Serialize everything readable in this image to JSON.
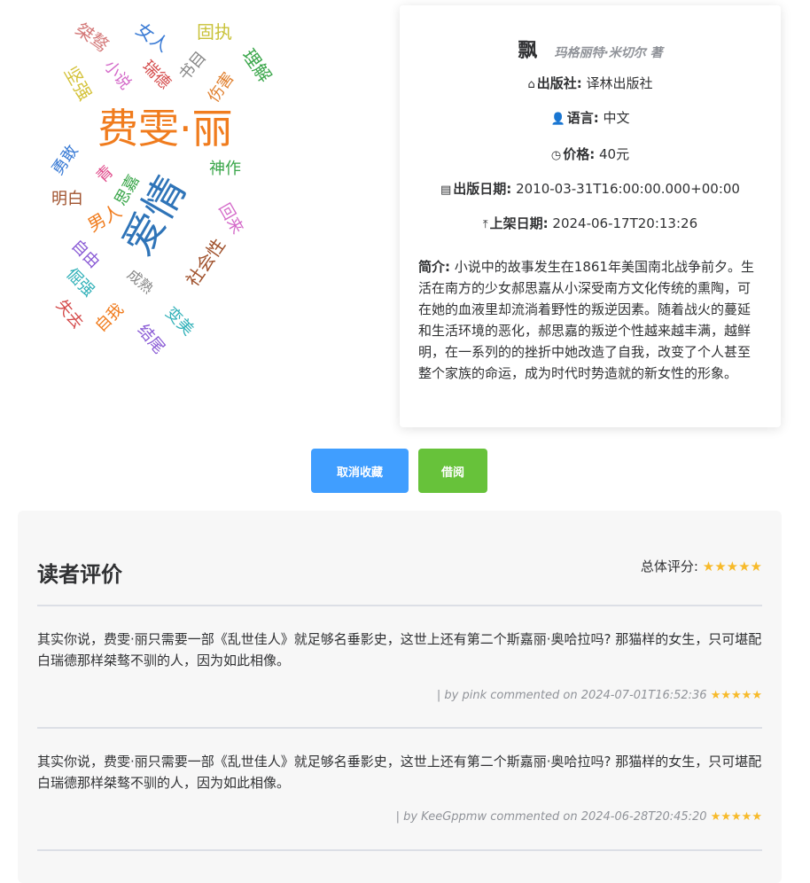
{
  "word_cloud": [
    {
      "text": "桀骜",
      "color": "#d47a7a"
    },
    {
      "text": "女人",
      "color": "#3a7bd5"
    },
    {
      "text": "固执",
      "color": "#c9c238"
    },
    {
      "text": "理解",
      "color": "#3aa64a"
    },
    {
      "text": "坚强",
      "color": "#d4c23a"
    },
    {
      "text": "小说",
      "color": "#d46ac9"
    },
    {
      "text": "瑞德",
      "color": "#d44a4a"
    },
    {
      "text": "书目",
      "color": "#888888"
    },
    {
      "text": "伤害",
      "color": "#e0802f"
    },
    {
      "text": "费雯·丽",
      "color": "#f07c1e"
    },
    {
      "text": "勇敢",
      "color": "#3a7bd5"
    },
    {
      "text": "青",
      "color": "#e04a8a"
    },
    {
      "text": "思嘉",
      "color": "#3aa64a"
    },
    {
      "text": "爱情",
      "color": "#2f74b8"
    },
    {
      "text": "神作",
      "color": "#3aa64a"
    },
    {
      "text": "明白",
      "color": "#a0522d"
    },
    {
      "text": "男人",
      "color": "#f07c1e"
    },
    {
      "text": "回来",
      "color": "#d46ac9"
    },
    {
      "text": "自由",
      "color": "#8a5bd5"
    },
    {
      "text": "社会性",
      "color": "#a0522d"
    },
    {
      "text": "倔强",
      "color": "#2fb0b8"
    },
    {
      "text": "成熟",
      "color": "#888888"
    },
    {
      "text": "失去",
      "color": "#d44a4a"
    },
    {
      "text": "自我",
      "color": "#f07c1e"
    },
    {
      "text": "变美",
      "color": "#2fb0b8"
    },
    {
      "text": "结尾",
      "color": "#8a5bd5"
    }
  ],
  "book": {
    "title": "飘",
    "author": "玛格丽特·米切尔 著",
    "publisher_label": "出版社:",
    "publisher": "译林出版社",
    "language_label": "语言:",
    "language": "中文",
    "price_label": "价格:",
    "price": "40元",
    "pub_date_label": "出版日期:",
    "pub_date": "2010-03-31T16:00:00.000+00:00",
    "shelf_date_label": "上架日期:",
    "shelf_date": "2024-06-17T20:13:26",
    "intro_label": "简介:",
    "intro": "小说中的故事发生在1861年美国南北战争前夕。生活在南方的少女郝思嘉从小深受南方文化传统的熏陶，可在她的血液里却流淌着野性的叛逆因素。随着战火的蔓延和生活环境的恶化，郝思嘉的叛逆个性越来越丰满，越鲜明，在一系列的的挫折中她改造了自我，改变了个人甚至整个家族的命运，成为时代时势造就的新女性的形象。"
  },
  "actions": {
    "cancel_favorite": "取消收藏",
    "borrow": "借阅"
  },
  "reviews": {
    "title": "读者评价",
    "overall_label": "总体评分:",
    "overall_stars": "★★★★★",
    "items": [
      {
        "text": "其实你说，费雯·丽只需要一部《乱世佳人》就足够名垂影史，这世上还有第二个斯嘉丽·奥哈拉吗? 那猫样的女生，只可堪配白瑞德那样桀骜不驯的人，因为如此相像。",
        "meta": "| by pink commented on 2024-07-01T16:52:36",
        "stars": "★★★★★"
      },
      {
        "text": "其实你说，费雯·丽只需要一部《乱世佳人》就足够名垂影史，这世上还有第二个斯嘉丽·奥哈拉吗? 那猫样的女生，只可堪配白瑞德那样桀骜不驯的人，因为如此相像。",
        "meta": "| by KeeGppmw commented on 2024-06-28T20:45:20",
        "stars": "★★★★★"
      }
    ]
  }
}
